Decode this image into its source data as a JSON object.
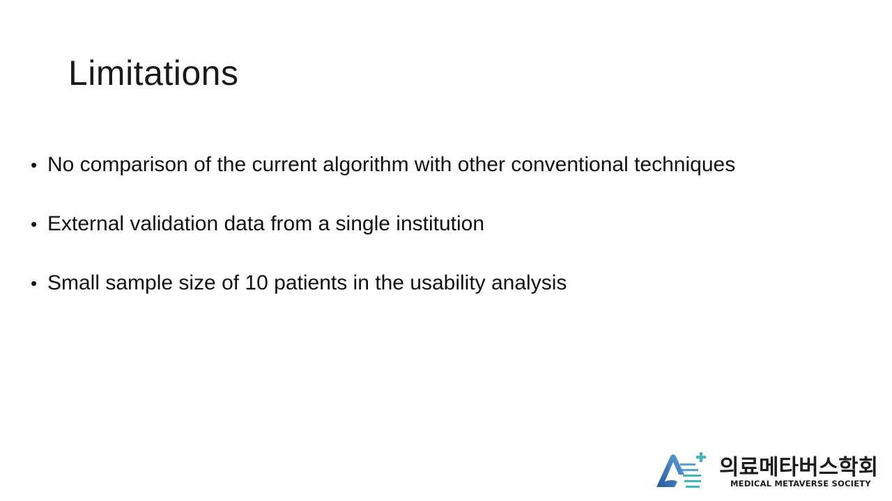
{
  "slide": {
    "title": "Limitations",
    "bullets": [
      {
        "text": "No comparison of the current algorithm with other conventional techniques"
      },
      {
        "text": "External validation data from a single institution"
      },
      {
        "text": "Small sample size of 10 patients in the usability analysis"
      }
    ],
    "bullet_glyph": "•"
  },
  "logo": {
    "name_korean": "의료메타버스학회",
    "name_english": "MEDICAL METAVERSE SOCIETY",
    "mark_icon": "medical-metaverse-a-logo-icon",
    "colors": {
      "blue_dark": "#2b5a9c",
      "blue_light": "#5aa0d8",
      "teal": "#3fb6b8"
    }
  }
}
